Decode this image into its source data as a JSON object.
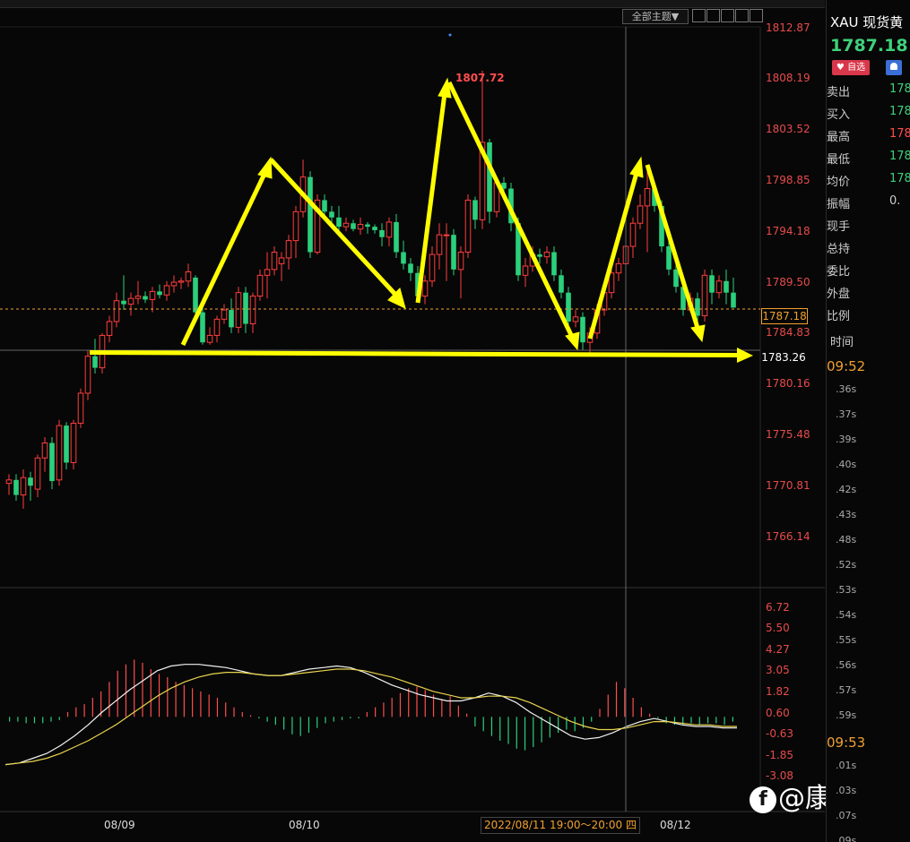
{
  "toolbar": {
    "theme_label": "全部主题▼"
  },
  "quote_panel": {
    "symbol": "XAU 现货黄",
    "price": "1787.18 ↓",
    "favorite_label": "自选",
    "rows": [
      {
        "label": "卖出",
        "value": "178",
        "color": "#3fd07a"
      },
      {
        "label": "买入",
        "value": "178",
        "color": "#3fd07a"
      },
      {
        "label": "最高",
        "value": "178",
        "color": "#ff4d4d"
      },
      {
        "label": "最低",
        "value": "178",
        "color": "#3fd07a"
      },
      {
        "label": "均价",
        "value": "178",
        "color": "#3fd07a"
      },
      {
        "label": "振幅",
        "value": "0.",
        "color": "#cccccc"
      },
      {
        "label": "现手",
        "value": "",
        "color": "#cccccc"
      },
      {
        "label": "总持",
        "value": "",
        "color": "#cccccc"
      },
      {
        "label": "委比",
        "value": "",
        "color": "#cccccc"
      },
      {
        "label": "外盘",
        "value": "",
        "color": "#cccccc"
      },
      {
        "label": "比例",
        "value": "",
        "color": "#cccccc"
      }
    ],
    "time_header": "时间",
    "time_top": "09:52",
    "time_bottom": "09:53",
    "ticks_top": [
      ".36s",
      ".37s",
      ".39s",
      ".40s",
      ".42s",
      ".43s",
      ".48s",
      ".52s",
      ".53s",
      ".54s",
      ".55s",
      ".56s",
      ".57s",
      ".59s"
    ],
    "ticks_bottom": [
      ".01s",
      ".03s",
      ".07s",
      ".09s"
    ]
  },
  "chart_data": {
    "type": "candlestick",
    "symbol": "XAU",
    "y_axis_labels": [
      "1812.87",
      "1808.19",
      "1803.52",
      "1798.85",
      "1794.18",
      "1789.50",
      "1784.83",
      "1780.16",
      "1775.48",
      "1770.81",
      "1766.14"
    ],
    "ylim": [
      1765,
      1813.5
    ],
    "x_axis_labels": [
      "08/09",
      "08/10",
      "08/12"
    ],
    "crosshair_label": "2022/08/11 19:00～20:00 四",
    "current_price": "1787.18",
    "support_price": "1783.26",
    "peak_label": "1807.72",
    "candles": [
      [
        1772.0,
        1772.8,
        1771.0,
        1772.3
      ],
      [
        1772.3,
        1772.8,
        1770.5,
        1771.0
      ],
      [
        1771.0,
        1773.2,
        1769.8,
        1772.5
      ],
      [
        1772.5,
        1773.0,
        1770.5,
        1771.8
      ],
      [
        1771.5,
        1774.5,
        1770.8,
        1774.2
      ],
      [
        1774.2,
        1776.0,
        1773.0,
        1775.5
      ],
      [
        1775.5,
        1776.0,
        1771.5,
        1772.2
      ],
      [
        1772.3,
        1777.5,
        1771.8,
        1777.0
      ],
      [
        1777.0,
        1777.3,
        1773.2,
        1773.8
      ],
      [
        1773.8,
        1777.5,
        1773.2,
        1777.2
      ],
      [
        1777.2,
        1780.2,
        1776.8,
        1779.8
      ],
      [
        1779.8,
        1783.5,
        1779.2,
        1783.0
      ],
      [
        1783.0,
        1784.5,
        1781.5,
        1782.0
      ],
      [
        1782.0,
        1785.0,
        1781.5,
        1784.8
      ],
      [
        1784.8,
        1786.5,
        1784.2,
        1786.0
      ],
      [
        1786.0,
        1788.5,
        1785.5,
        1787.8
      ],
      [
        1787.8,
        1790.0,
        1787.0,
        1787.5
      ],
      [
        1787.5,
        1788.5,
        1786.5,
        1788.0
      ],
      [
        1788.0,
        1789.5,
        1787.5,
        1788.2
      ],
      [
        1788.2,
        1788.6,
        1787.6,
        1787.9
      ],
      [
        1787.9,
        1789.0,
        1786.8,
        1788.6
      ],
      [
        1788.6,
        1789.2,
        1788.0,
        1788.3
      ],
      [
        1788.3,
        1789.5,
        1787.8,
        1789.1
      ],
      [
        1789.1,
        1790.0,
        1788.5,
        1789.4
      ],
      [
        1789.4,
        1789.8,
        1788.8,
        1789.5
      ],
      [
        1789.5,
        1791.0,
        1789.0,
        1790.3
      ],
      [
        1789.8,
        1790.0,
        1786.5,
        1786.8
      ],
      [
        1786.8,
        1788.0,
        1784.0,
        1784.2
      ],
      [
        1784.2,
        1785.5,
        1784.0,
        1784.8
      ],
      [
        1784.8,
        1786.5,
        1784.2,
        1786.2
      ],
      [
        1786.2,
        1787.5,
        1785.8,
        1787.0
      ],
      [
        1787.0,
        1788.0,
        1785.0,
        1785.5
      ],
      [
        1785.5,
        1789.0,
        1785.0,
        1788.5
      ],
      [
        1788.5,
        1789.0,
        1785.0,
        1785.8
      ],
      [
        1785.8,
        1788.5,
        1785.0,
        1788.2
      ],
      [
        1788.2,
        1790.5,
        1787.8,
        1790.0
      ],
      [
        1790.0,
        1792.0,
        1788.0,
        1790.5
      ],
      [
        1790.5,
        1792.5,
        1790.0,
        1792.0
      ],
      [
        1791.0,
        1792.0,
        1789.5,
        1791.5
      ],
      [
        1791.5,
        1793.5,
        1790.5,
        1793.0
      ],
      [
        1793.0,
        1796.0,
        1791.5,
        1795.5
      ],
      [
        1795.5,
        1800.0,
        1795.0,
        1798.5
      ],
      [
        1798.5,
        1799.0,
        1791.5,
        1792.0
      ],
      [
        1792.0,
        1797.0,
        1791.8,
        1796.5
      ],
      [
        1796.5,
        1797.0,
        1795.0,
        1795.5
      ],
      [
        1795.5,
        1796.0,
        1794.5,
        1795.0
      ],
      [
        1795.0,
        1796.0,
        1793.8,
        1794.2
      ],
      [
        1794.2,
        1795.0,
        1793.8,
        1794.5
      ],
      [
        1794.5,
        1794.8,
        1793.8,
        1794.0
      ],
      [
        1794.0,
        1795.0,
        1793.5,
        1794.4
      ],
      [
        1794.4,
        1794.6,
        1793.6,
        1794.2
      ],
      [
        1794.2,
        1794.4,
        1793.6,
        1793.9
      ],
      [
        1793.9,
        1794.5,
        1792.5,
        1793.3
      ],
      [
        1793.3,
        1795.0,
        1792.5,
        1794.6
      ],
      [
        1794.6,
        1795.3,
        1791.5,
        1792.0
      ],
      [
        1792.0,
        1793.0,
        1790.5,
        1791.0
      ],
      [
        1791.0,
        1791.5,
        1789.5,
        1790.2
      ],
      [
        1790.2,
        1790.8,
        1787.8,
        1788.2
      ],
      [
        1788.2,
        1790.0,
        1787.5,
        1789.5
      ],
      [
        1789.5,
        1792.5,
        1789.0,
        1791.8
      ],
      [
        1791.8,
        1794.5,
        1790.5,
        1793.5
      ],
      [
        1793.5,
        1794.5,
        1789.5,
        1793.5
      ],
      [
        1793.5,
        1794.0,
        1790.0,
        1790.5
      ],
      [
        1790.5,
        1792.5,
        1788.0,
        1792.0
      ],
      [
        1792.0,
        1797.0,
        1791.5,
        1796.5
      ],
      [
        1796.5,
        1796.8,
        1794.0,
        1794.8
      ],
      [
        1794.8,
        1807.7,
        1794.0,
        1801.5
      ],
      [
        1801.5,
        1801.8,
        1794.5,
        1795.5
      ],
      [
        1795.5,
        1798.5,
        1795.0,
        1798.0
      ],
      [
        1798.0,
        1798.5,
        1796.8,
        1797.5
      ],
      [
        1797.5,
        1798.0,
        1793.8,
        1794.5
      ],
      [
        1794.5,
        1795.0,
        1789.5,
        1790.0
      ],
      [
        1790.0,
        1791.5,
        1789.0,
        1790.8
      ],
      [
        1790.8,
        1792.5,
        1790.3,
        1791.8
      ],
      [
        1791.8,
        1792.3,
        1791.0,
        1791.6
      ],
      [
        1791.6,
        1792.5,
        1791.0,
        1792.0
      ],
      [
        1792.0,
        1792.5,
        1789.5,
        1790.0
      ],
      [
        1790.0,
        1790.5,
        1788.0,
        1788.5
      ],
      [
        1788.5,
        1789.0,
        1785.5,
        1786.0
      ],
      [
        1786.0,
        1787.0,
        1785.5,
        1786.4
      ],
      [
        1786.4,
        1786.8,
        1783.5,
        1784.2
      ],
      [
        1784.2,
        1785.5,
        1783.3,
        1785.0
      ],
      [
        1785.0,
        1787.5,
        1784.5,
        1787.0
      ],
      [
        1787.0,
        1789.0,
        1786.5,
        1788.5
      ],
      [
        1788.5,
        1790.5,
        1788.0,
        1790.2
      ],
      [
        1790.2,
        1791.5,
        1789.5,
        1791.0
      ],
      [
        1791.0,
        1793.5,
        1790.5,
        1792.5
      ],
      [
        1792.5,
        1795.0,
        1791.5,
        1794.5
      ],
      [
        1794.5,
        1797.0,
        1794.0,
        1796.0
      ],
      [
        1796.0,
        1799.0,
        1792.0,
        1797.5
      ],
      [
        1797.5,
        1798.0,
        1795.5,
        1796.0
      ],
      [
        1796.0,
        1796.5,
        1792.0,
        1792.5
      ],
      [
        1792.5,
        1793.0,
        1790.0,
        1790.5
      ],
      [
        1790.5,
        1791.0,
        1788.5,
        1789.0
      ],
      [
        1789.0,
        1789.5,
        1786.5,
        1787.0
      ],
      [
        1787.0,
        1788.5,
        1786.8,
        1788.0
      ],
      [
        1788.0,
        1788.5,
        1786.0,
        1786.5
      ],
      [
        1786.5,
        1790.5,
        1786.0,
        1790.0
      ],
      [
        1790.0,
        1790.5,
        1787.5,
        1788.5
      ],
      [
        1788.5,
        1790.0,
        1788.0,
        1789.5
      ],
      [
        1789.5,
        1790.5,
        1787.5,
        1788.5
      ],
      [
        1788.5,
        1789.8,
        1787.5,
        1787.2
      ]
    ],
    "macd": {
      "axis_labels": [
        "6.72",
        "5.50",
        "4.27",
        "3.05",
        "1.82",
        "0.60",
        "-0.63",
        "-1.85",
        "-3.08"
      ],
      "ylim": [
        -3.7,
        7.0
      ],
      "dif": [
        -3.0,
        -2.9,
        -2.6,
        -2.3,
        -1.8,
        -1.2,
        -0.5,
        0.3,
        1.0,
        1.7,
        2.3,
        2.9,
        3.2,
        3.3,
        3.3,
        3.2,
        3.1,
        2.9,
        2.7,
        2.6,
        2.6,
        2.8,
        3.0,
        3.1,
        3.2,
        3.1,
        2.8,
        2.4,
        2.0,
        1.7,
        1.4,
        1.2,
        1.0,
        1.0,
        1.2,
        1.5,
        1.3,
        0.9,
        0.3,
        -0.2,
        -0.7,
        -1.2,
        -1.4,
        -1.3,
        -1.0,
        -0.6,
        -0.3,
        -0.1,
        -0.3,
        -0.5,
        -0.6,
        -0.6,
        -0.7,
        -0.7
      ],
      "dea": [
        -3.0,
        -2.9,
        -2.8,
        -2.6,
        -2.3,
        -1.9,
        -1.5,
        -1.0,
        -0.5,
        0.1,
        0.7,
        1.3,
        1.8,
        2.2,
        2.5,
        2.7,
        2.8,
        2.8,
        2.7,
        2.6,
        2.6,
        2.7,
        2.8,
        2.9,
        3.0,
        3.0,
        2.9,
        2.7,
        2.5,
        2.2,
        1.9,
        1.6,
        1.4,
        1.2,
        1.2,
        1.3,
        1.3,
        1.2,
        0.9,
        0.5,
        0.1,
        -0.3,
        -0.6,
        -0.8,
        -0.8,
        -0.7,
        -0.5,
        -0.3,
        -0.3,
        -0.4,
        -0.5,
        -0.5,
        -0.6,
        -0.6
      ],
      "hist": [
        -0.3,
        -0.3,
        -0.4,
        -0.4,
        -0.4,
        -0.3,
        -0.2,
        0.3,
        0.6,
        0.8,
        1.2,
        1.6,
        2.2,
        2.9,
        3.3,
        3.6,
        3.4,
        3.0,
        2.7,
        2.5,
        2.2,
        2.0,
        1.8,
        1.6,
        1.4,
        1.2,
        0.9,
        0.6,
        0.3,
        0.1,
        -0.1,
        -0.3,
        -0.5,
        -0.8,
        -1.1,
        -1.2,
        -1.0,
        -0.7,
        -0.4,
        -0.3,
        -0.2,
        -0.1,
        -0.1,
        0.3,
        0.6,
        0.9,
        1.2,
        1.5,
        1.8,
        1.9,
        1.7,
        1.4,
        1.1,
        1.3,
        0.7,
        0.2,
        -0.6,
        -0.9,
        -1.2,
        -1.5,
        -1.7,
        -2.0,
        -2.1,
        -1.9,
        -1.6,
        -1.3,
        -1.0,
        -0.8,
        -0.9,
        -0.7,
        -0.3,
        0.5,
        1.4,
        2.2,
        1.8,
        1.2,
        0.6,
        0.2,
        -0.1,
        -0.4,
        -0.5,
        -0.5,
        -0.4,
        -0.5,
        -0.4,
        -0.4,
        -0.5,
        -0.3
      ]
    }
  },
  "watermark": "@康姑娘"
}
